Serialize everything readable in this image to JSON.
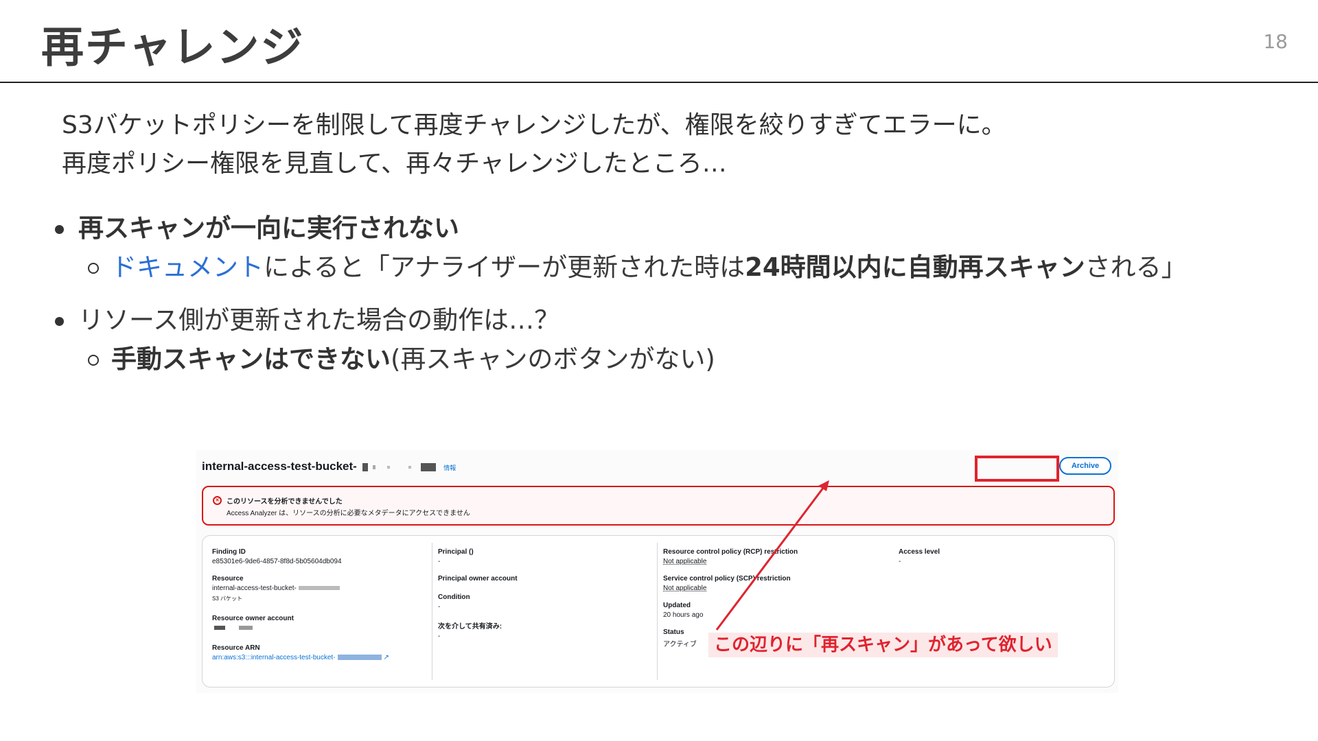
{
  "slide": {
    "title": "再チャレンジ",
    "page_number": "18",
    "intro_line1": "S3バケットポリシーを制限して再度チャレンジしたが、権限を絞りすぎてエラーに。",
    "intro_line2": "再度ポリシー権限を見直して、再々チャレンジしたところ…",
    "bullet1": "再スキャンが一向に実行されない",
    "bullet1_sub_link": "ドキュメント",
    "bullet1_sub_text1": "によると「アナライザーが更新された時は",
    "bullet1_sub_bold": "24時間以内に自動再スキャン",
    "bullet1_sub_text2": "される」",
    "bullet2": "リソース側が更新された場合の動作は…？",
    "bullet2_sub_bold": "手動スキャンはできない",
    "bullet2_sub_text": "(再スキャンのボタンがない)"
  },
  "screenshot": {
    "title": "internal-access-test-bucket-",
    "info_link": "情報",
    "archive_button": "Archive",
    "alert_title": "このリソースを分析できませんでした",
    "alert_message": "Access Analyzer は、リソースの分析に必要なメタデータにアクセスできません",
    "fields": {
      "finding_id_label": "Finding ID",
      "finding_id_value": "e85301e6-9de6-4857-8f8d-5b05604db094",
      "resource_label": "Resource",
      "resource_value": "internal-access-test-bucket-",
      "resource_type": "S3 バケット",
      "owner_account_label": "Resource owner account",
      "arn_label": "Resource ARN",
      "arn_value": "arn:aws:s3:::internal-access-test-bucket-",
      "principal_label": "Principal ()",
      "principal_value": "-",
      "principal_owner_label": "Principal owner account",
      "condition_label": "Condition",
      "condition_value": "-",
      "shared_via_label": "次を介して共有済み:",
      "shared_via_value": "-",
      "rcp_label": "Resource control policy (RCP) restriction",
      "rcp_value": "Not applicable",
      "scp_label": "Service control policy (SCP) restriction",
      "scp_value": "Not applicable",
      "updated_label": "Updated",
      "updated_value": "20 hours ago",
      "status_label": "Status",
      "status_value": "アクティブ",
      "access_level_label": "Access level",
      "access_level_value": "-"
    },
    "annotation": "この辺りに「再スキャン」があって欲しい"
  },
  "colors": {
    "link_blue": "#2b6fd6",
    "aws_blue": "#0972d3",
    "alert_red": "#d91515",
    "annotation_red": "#e0232f"
  }
}
